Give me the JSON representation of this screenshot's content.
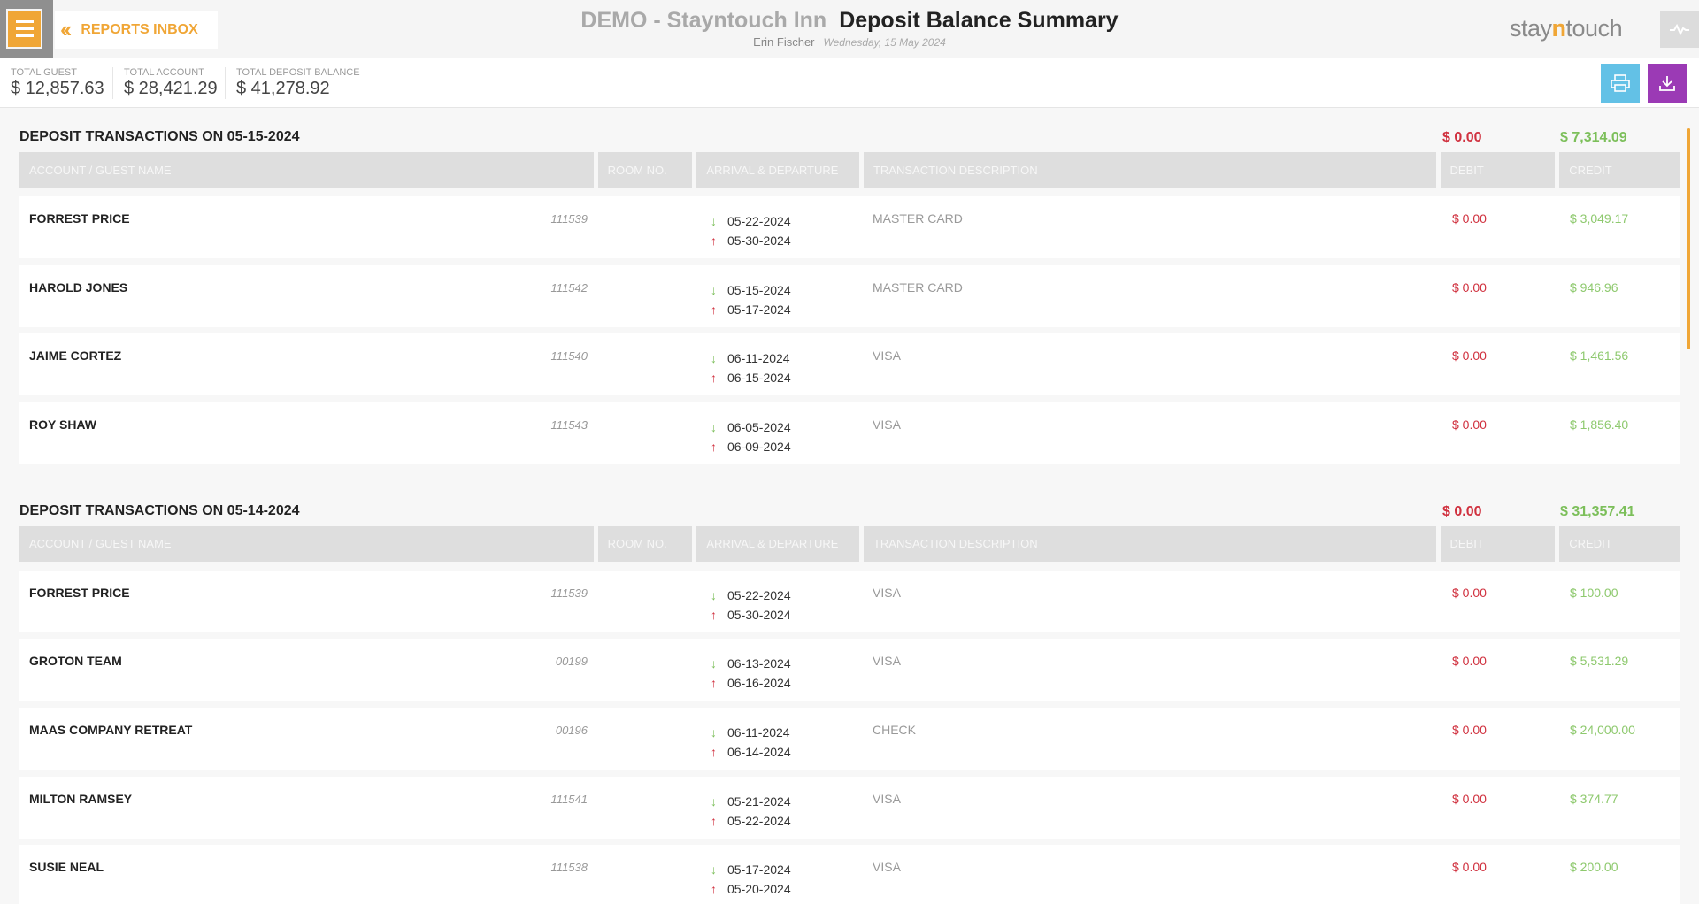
{
  "header": {
    "back_label": "REPORTS INBOX",
    "hotel": "DEMO - Stayntouch Inn",
    "report_title": "Deposit Balance Summary",
    "user": "Erin Fischer",
    "date": "Wednesday, 15 May 2024",
    "logo_a": "stay",
    "logo_n": "n",
    "logo_b": "touch"
  },
  "totals": {
    "guest_label": "TOTAL GUEST",
    "guest_value": "$ 12,857.63",
    "account_label": "TOTAL ACCOUNT",
    "account_value": "$ 28,421.29",
    "deposit_label": "TOTAL DEPOSIT BALANCE",
    "deposit_value": "$ 41,278.92"
  },
  "columns": {
    "name": "ACCOUNT / GUEST NAME",
    "room": "ROOM NO.",
    "arrival": "ARRIVAL & DEPARTURE",
    "description": "TRANSACTION DESCRIPTION",
    "debit": "DEBIT",
    "credit": "CREDIT"
  },
  "sections": [
    {
      "title": "DEPOSIT TRANSACTIONS ON 05-15-2024",
      "debit_total": "$ 0.00",
      "credit_total": "$ 7,314.09",
      "rows": [
        {
          "name": "FORREST PRICE",
          "room": "111539",
          "arrival": "05-22-2024",
          "departure": "05-30-2024",
          "desc": "MASTER CARD",
          "debit": "$ 0.00",
          "credit": "$ 3,049.17"
        },
        {
          "name": "HAROLD JONES",
          "room": "111542",
          "arrival": "05-15-2024",
          "departure": "05-17-2024",
          "desc": "MASTER CARD",
          "debit": "$ 0.00",
          "credit": "$ 946.96"
        },
        {
          "name": "JAIME CORTEZ",
          "room": "111540",
          "arrival": "06-11-2024",
          "departure": "06-15-2024",
          "desc": "VISA",
          "debit": "$ 0.00",
          "credit": "$ 1,461.56"
        },
        {
          "name": "ROY SHAW",
          "room": "111543",
          "arrival": "06-05-2024",
          "departure": "06-09-2024",
          "desc": "VISA",
          "debit": "$ 0.00",
          "credit": "$ 1,856.40"
        }
      ]
    },
    {
      "title": "DEPOSIT TRANSACTIONS ON 05-14-2024",
      "debit_total": "$ 0.00",
      "credit_total": "$ 31,357.41",
      "rows": [
        {
          "name": "FORREST PRICE",
          "room": "111539",
          "arrival": "05-22-2024",
          "departure": "05-30-2024",
          "desc": "VISA",
          "debit": "$ 0.00",
          "credit": "$ 100.00"
        },
        {
          "name": "GROTON TEAM",
          "room": "00199",
          "arrival": "06-13-2024",
          "departure": "06-16-2024",
          "desc": "VISA",
          "debit": "$ 0.00",
          "credit": "$ 5,531.29"
        },
        {
          "name": "MAAS COMPANY RETREAT",
          "room": "00196",
          "arrival": "06-11-2024",
          "departure": "06-14-2024",
          "desc": "CHECK",
          "debit": "$ 0.00",
          "credit": "$ 24,000.00"
        },
        {
          "name": "MILTON RAMSEY",
          "room": "111541",
          "arrival": "05-21-2024",
          "departure": "05-22-2024",
          "desc": "VISA",
          "debit": "$ 0.00",
          "credit": "$ 374.77"
        },
        {
          "name": "SUSIE NEAL",
          "room": "111538",
          "arrival": "05-17-2024",
          "departure": "05-20-2024",
          "desc": "VISA",
          "debit": "$ 0.00",
          "credit": "$ 200.00"
        }
      ]
    }
  ],
  "icons": {
    "menu": "hamburger-icon",
    "back": "double-chevron-left-icon",
    "activity": "activity-icon",
    "print": "print-icon",
    "download": "download-icon",
    "arrival": "arrow-down-icon",
    "departure": "arrow-up-icon"
  },
  "colors": {
    "accent": "#f0a636",
    "debit": "#d0303e",
    "credit": "#7cbf5a",
    "print_button": "#63c1e6",
    "download_button": "#9b3ab5"
  }
}
